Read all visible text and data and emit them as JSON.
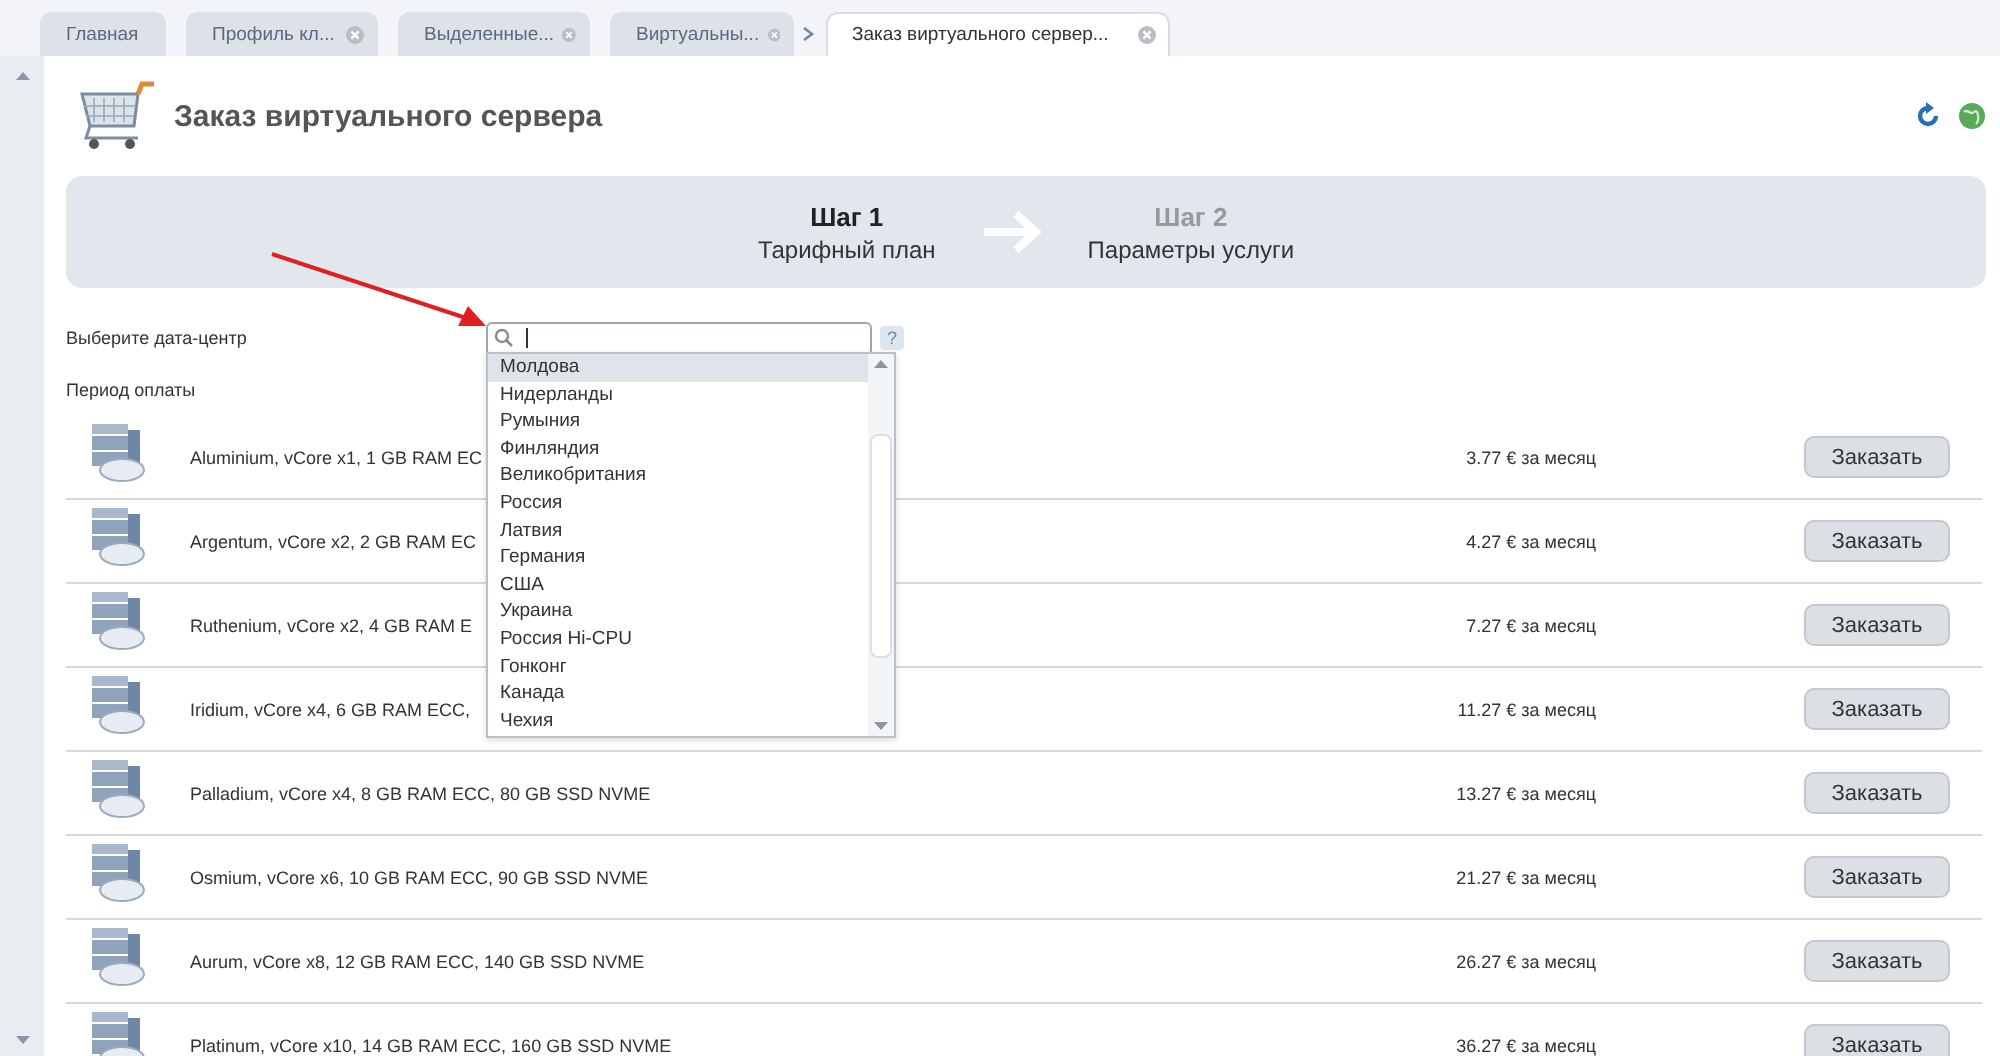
{
  "tabs": [
    {
      "label": "Главная",
      "closable": false,
      "selected": false
    },
    {
      "label": "Профиль кл...",
      "closable": true,
      "selected": false
    },
    {
      "label": "Выделенные...",
      "closable": true,
      "selected": false
    },
    {
      "label": "Виртуальны...",
      "closable": true,
      "selected": false
    },
    {
      "label": "Заказ виртуального сервер...",
      "closable": true,
      "selected": true
    }
  ],
  "page_title": "Заказ виртуального сервера",
  "steps": [
    {
      "title": "Шаг 1",
      "subtitle": "Тарифный план",
      "selected": true
    },
    {
      "title": "Шаг 2",
      "subtitle": "Параметры услуги",
      "selected": false
    }
  ],
  "datacenter": {
    "label": "Выберите дата-центр",
    "help": "?",
    "options": [
      {
        "label": "Молдова",
        "selected": true
      },
      {
        "label": "Нидерланды",
        "selected": false
      },
      {
        "label": "Румыния",
        "selected": false
      },
      {
        "label": "Финляндия",
        "selected": false
      },
      {
        "label": "Великобритания",
        "selected": false
      },
      {
        "label": "Россия",
        "selected": false
      },
      {
        "label": "Латвия",
        "selected": false
      },
      {
        "label": "Германия",
        "selected": false
      },
      {
        "label": "США",
        "selected": false
      },
      {
        "label": "Украина",
        "selected": false
      },
      {
        "label": "Россия Hi-CPU",
        "selected": false
      },
      {
        "label": "Гонконг",
        "selected": false
      },
      {
        "label": "Канада",
        "selected": false
      },
      {
        "label": "Чехия",
        "selected": false
      }
    ]
  },
  "period": {
    "label": "Период оплаты"
  },
  "plans": [
    {
      "name": "Aluminium, vCore x1, 1 GB RAM EC",
      "price": "3.77 € за месяц",
      "button": "Заказать"
    },
    {
      "name": "Argentum, vCore x2, 2 GB RAM EC",
      "price": "4.27 € за месяц",
      "button": "Заказать"
    },
    {
      "name": "Ruthenium, vCore x2, 4 GB RAM E",
      "price": "7.27 € за месяц",
      "button": "Заказать"
    },
    {
      "name": "Iridium, vCore x4, 6 GB RAM ECC,",
      "price": "11.27 € за месяц",
      "button": "Заказать"
    },
    {
      "name": "Palladium, vCore x4, 8 GB RAM ECC, 80 GB SSD NVME",
      "price": "13.27 € за месяц",
      "button": "Заказать"
    },
    {
      "name": "Osmium, vCore x6, 10 GB RAM ECC, 90 GB SSD NVME",
      "price": "21.27 € за месяц",
      "button": "Заказать"
    },
    {
      "name": "Aurum, vCore x8, 12 GB RAM ECC, 140 GB SSD NVME",
      "price": "26.27 € за месяц",
      "button": "Заказать"
    },
    {
      "name": "Platinum, vCore x10, 14 GB RAM ECC, 160 GB SSD NVME",
      "price": "36.27 € за месяц",
      "button": "Заказать"
    }
  ]
}
